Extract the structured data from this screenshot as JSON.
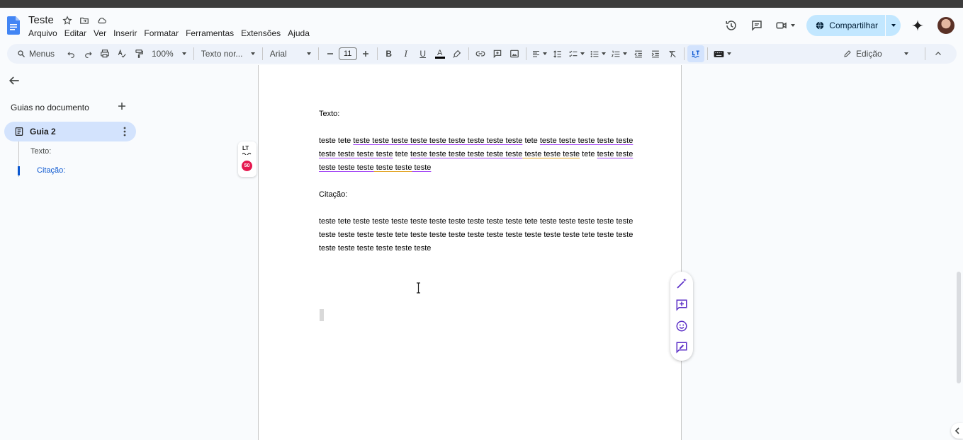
{
  "document": {
    "title": "Teste"
  },
  "menu": [
    "Arquivo",
    "Editar",
    "Ver",
    "Inserir",
    "Formatar",
    "Ferramentas",
    "Extensões",
    "Ajuda"
  ],
  "header": {
    "share_label": "Compartilhar"
  },
  "toolbar": {
    "search_label": "Menus",
    "zoom": "100%",
    "style": "Texto nor...",
    "font": "Arial",
    "font_size": "11",
    "mode": "Edição"
  },
  "sidebar": {
    "guides_title": "Guias no documento",
    "tab_label": "Guia 2",
    "outline": [
      "Texto:",
      "Citação:"
    ]
  },
  "languagetool": {
    "logo": "LT",
    "count": "50"
  },
  "content": {
    "heading1": "Texto:",
    "para1": {
      "line1": [
        {
          "t": "teste tete ",
          "u": ""
        },
        {
          "t": "teste teste teste teste teste teste teste teste teste",
          "u": "p"
        },
        {
          "t": " tete ",
          "u": ""
        },
        {
          "t": "teste teste teste teste teste",
          "u": "p"
        }
      ],
      "line2": [
        {
          "t": "teste teste teste teste",
          "u": "p"
        },
        {
          "t": " tete ",
          "u": ""
        },
        {
          "t": "teste teste teste teste teste teste",
          "u": "p"
        },
        {
          "t": " teste teste teste",
          "u": "o"
        },
        {
          "t": " tete ",
          "u": ""
        },
        {
          "t": "teste teste",
          "u": "p"
        }
      ],
      "line3": [
        {
          "t": "teste teste teste",
          "u": "p"
        },
        {
          "t": " teste teste",
          "u": "o"
        },
        {
          "t": " teste",
          "u": "p"
        }
      ]
    },
    "heading2": "Citação:",
    "para2": {
      "line1": "teste tete teste teste teste teste teste teste teste teste teste tete teste teste teste teste teste",
      "line2": "teste teste teste teste tete teste teste teste teste teste teste teste teste teste tete teste teste",
      "line3": "teste teste teste teste teste teste"
    }
  },
  "colors": {
    "accent": "#0b57d0",
    "share_bg": "#c2e7ff",
    "active_tab": "#d3e3fd",
    "underline_purple": "#a142f4",
    "underline_orange": "#e2a321",
    "lt_badge": "#e5184f",
    "float_icon": "#5b2fc7"
  }
}
